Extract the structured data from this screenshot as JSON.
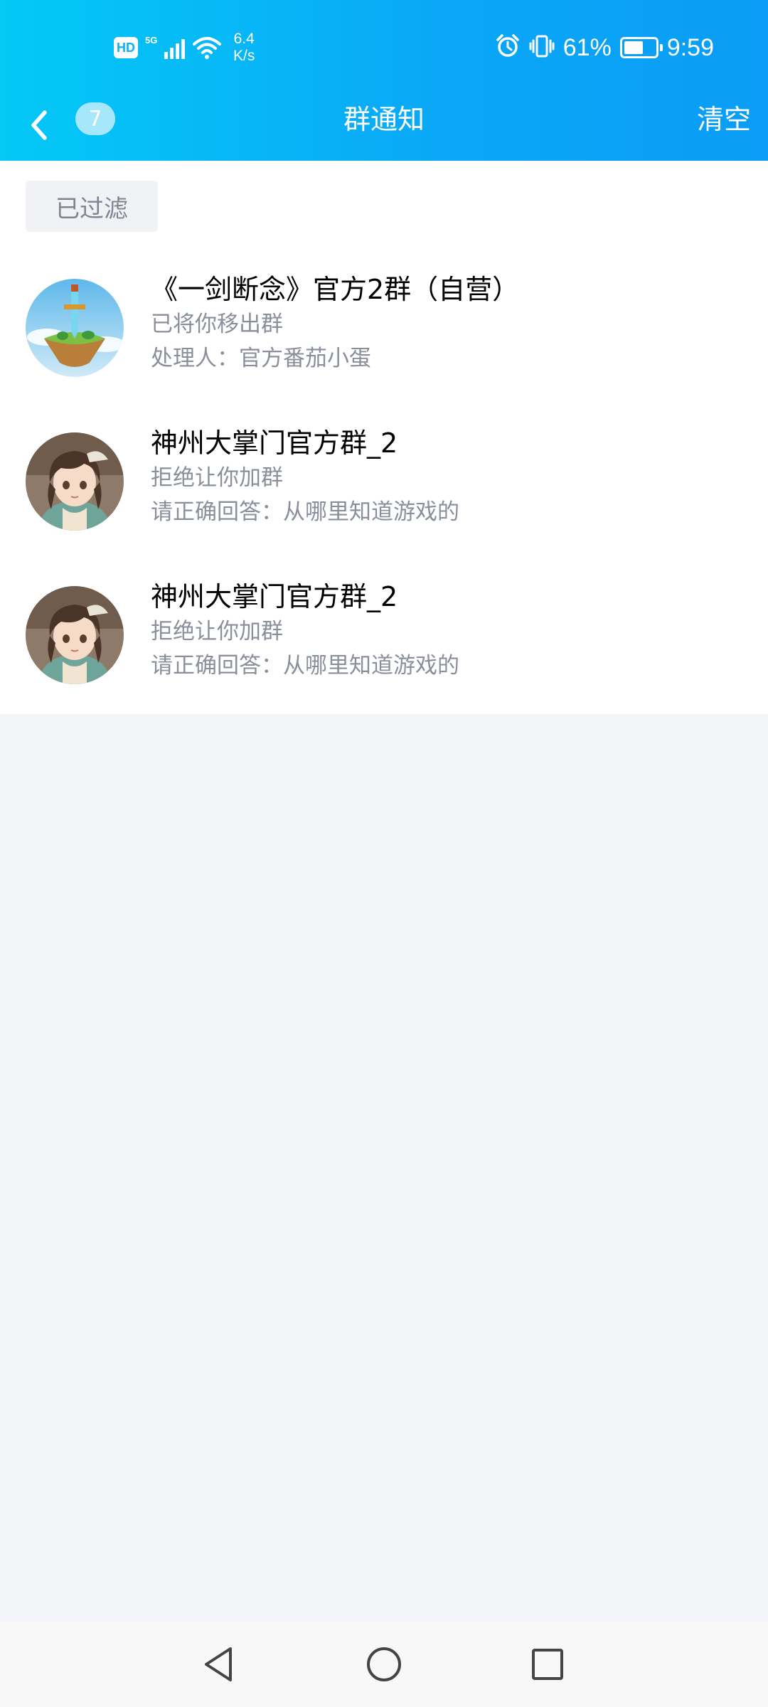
{
  "status_bar": {
    "hd_label": "HD",
    "network_type": "5G",
    "net_speed_value": "6.4",
    "net_speed_unit": "K/s",
    "battery_percent": "61%",
    "battery_level": 0.61,
    "time": "9:59"
  },
  "header": {
    "unread_count": "7",
    "title": "群通知",
    "clear_label": "清空"
  },
  "filter": {
    "label": "已过滤"
  },
  "notices": [
    {
      "group_name": "《一剑断念》官方2群（自营）",
      "status": "已将你移出群",
      "detail": "处理人：官方番茄小蛋",
      "avatar": "floating-island-sword-avatar"
    },
    {
      "group_name": "神州大掌门官方群_2",
      "status": "拒绝让你加群",
      "detail": "请正确回答：从哪里知道游戏的",
      "avatar": "anime-girl-avatar"
    },
    {
      "group_name": "神州大掌门官方群_2",
      "status": "拒绝让你加群",
      "detail": "请正确回答：从哪里知道游戏的",
      "avatar": "anime-girl-avatar"
    }
  ],
  "colors": {
    "header_gradient_start": "#03c9f6",
    "header_gradient_end": "#0a9cf6",
    "secondary_text": "#8a8f9c",
    "page_background": "#f3f5f9"
  }
}
